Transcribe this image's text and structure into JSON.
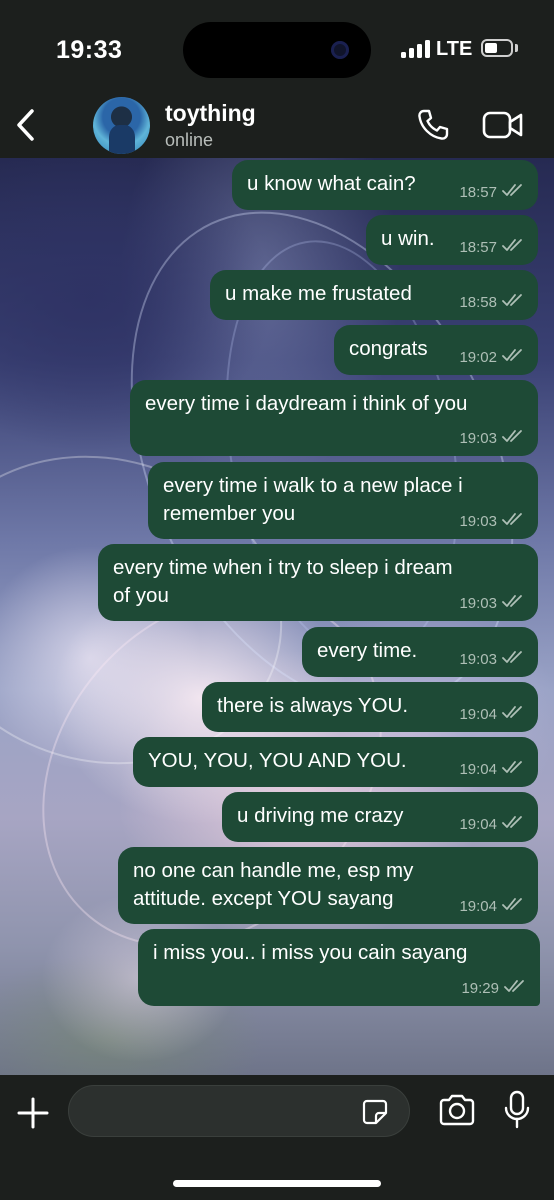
{
  "status_bar": {
    "time": "19:33",
    "network": "LTE",
    "battery_level": 0.5
  },
  "header": {
    "back_icon": "chevron-left-icon",
    "contact_name": "toything",
    "contact_status": "online",
    "call_icon": "phone-icon",
    "video_icon": "video-camera-icon"
  },
  "messages": [
    {
      "text": "u know what cain?",
      "time": "18:57",
      "status": "read"
    },
    {
      "text": "u win.",
      "time": "18:57",
      "status": "read"
    },
    {
      "text": "u make me frustated",
      "time": "18:58",
      "status": "read"
    },
    {
      "text": "congrats",
      "time": "19:02",
      "status": "read"
    },
    {
      "text": "every time i daydream i think of you",
      "time": "19:03",
      "status": "read"
    },
    {
      "text": "every time i walk to a new place i\nremember you",
      "time": "19:03",
      "status": "read"
    },
    {
      "text": "every time when i try to sleep i dream\nof you",
      "time": "19:03",
      "status": "read"
    },
    {
      "text": "every time.",
      "time": "19:03",
      "status": "read"
    },
    {
      "text": "there is always YOU.",
      "time": "19:04",
      "status": "read"
    },
    {
      "text": "YOU, YOU, YOU AND YOU.",
      "time": "19:04",
      "status": "read"
    },
    {
      "text": "u driving me crazy",
      "time": "19:04",
      "status": "read"
    },
    {
      "text": "no one can handle me, esp my\nattitude. except YOU sayang",
      "time": "19:04",
      "status": "read"
    },
    {
      "text": "i miss you.. i miss you cain sayang",
      "time": "19:29",
      "status": "read"
    }
  ],
  "input_bar": {
    "attach_icon": "plus-icon",
    "message_placeholder": "",
    "sticker_icon": "sticker-icon",
    "camera_icon": "camera-icon",
    "mic_icon": "microphone-icon"
  },
  "colors": {
    "outgoing_bubble": "#1e4a36",
    "bar_background": "#1c1f1d",
    "meta_text": "#aebfb6"
  }
}
